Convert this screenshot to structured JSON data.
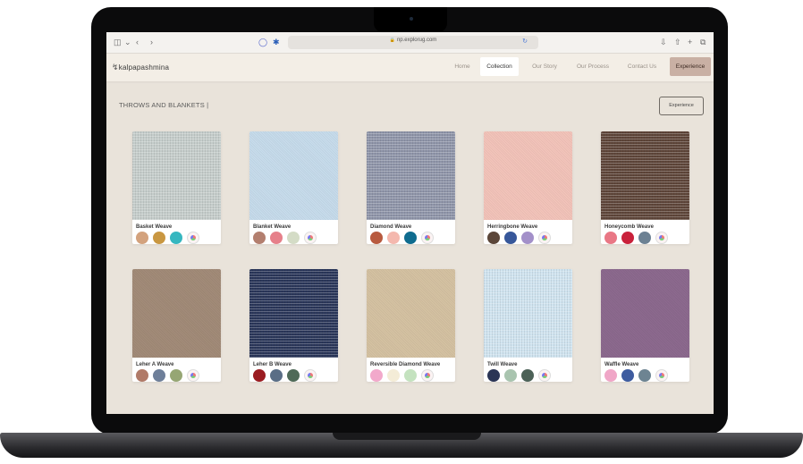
{
  "browser": {
    "url": "np.explorug.com",
    "lock_icon": "lock-icon",
    "sidebar_icon": "sidebar-icon",
    "share_icon": "share-icon",
    "new_tab_icon": "plus-icon",
    "tabs_icon": "tabs-icon",
    "download_icon": "download-icon"
  },
  "site": {
    "logo_text": "kalpapashmina",
    "nav": [
      "Home",
      "Collection",
      "Our Story",
      "Our Process",
      "Contact Us",
      "Experience"
    ],
    "active_nav": "Collection"
  },
  "page": {
    "title": "THROWS AND BLANKETS |",
    "experience_button": "Experience"
  },
  "products": [
    {
      "name": "Basket Weave",
      "color": "#c4ccca",
      "dots": [
        "#d3a27d",
        "#c99741",
        "#36b7c0"
      ]
    },
    {
      "name": "Blanket Weave",
      "color": "#c8dded",
      "dots": [
        "#b37f6f",
        "#e6808a",
        "#d4dcc6"
      ]
    },
    {
      "name": "Diamond Weave",
      "color": "#8e94a8",
      "dots": [
        "#b85a3f",
        "#f4b8ae",
        "#0f6c8f"
      ]
    },
    {
      "name": "Herringbone Weave",
      "color": "#f4c5bb",
      "dots": [
        "#5b4639",
        "#37579a",
        "#a390c9"
      ]
    },
    {
      "name": "Honeycomb Weave",
      "color": "#5e4539",
      "dots": [
        "#e97785",
        "#c9213b",
        "#6c8193"
      ]
    },
    {
      "name": "Leher A Weave",
      "color": "#a38c79",
      "dots": [
        "#b07a68",
        "#6e7f99",
        "#96a674"
      ]
    },
    {
      "name": "Leher B Weave",
      "color": "#2a3659",
      "dots": [
        "#9b1c21",
        "#5a6e86",
        "#4f6a58"
      ]
    },
    {
      "name": "Reversible Diamond Weave",
      "color": "#d6c3a3",
      "dots": [
        "#f2a9cb",
        "#f4ecd7",
        "#c4e2bf"
      ]
    },
    {
      "name": "Twill Weave",
      "color": "#cfe3ef",
      "dots": [
        "#2b3555",
        "#a9c4af",
        "#4c6157"
      ]
    },
    {
      "name": "Waffle Weave",
      "color": "#8d6a8f",
      "dots": [
        "#f0a6c7",
        "#3e5c9f",
        "#6d8492"
      ]
    }
  ]
}
